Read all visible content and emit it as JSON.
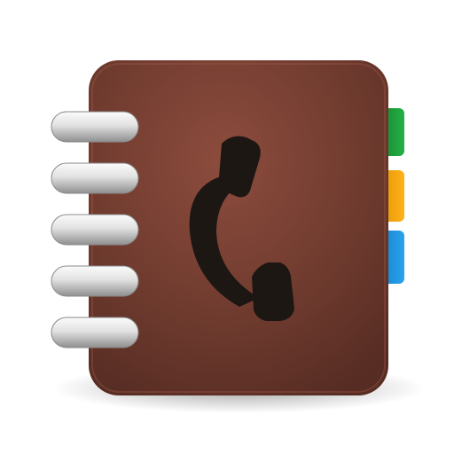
{
  "icon": {
    "name": "address-book-icon",
    "glyph": "phone-handset-icon"
  },
  "colors": {
    "cover_light": "#8a4a3c",
    "cover_dark": "#5c3026",
    "handset": "#1d1714",
    "tab_green": "#1f9a3a",
    "tab_orange": "#f2a100",
    "tab_blue": "#1c8fd8",
    "ring_light": "#f2f2f2",
    "ring_dark": "#9a9a9a"
  }
}
